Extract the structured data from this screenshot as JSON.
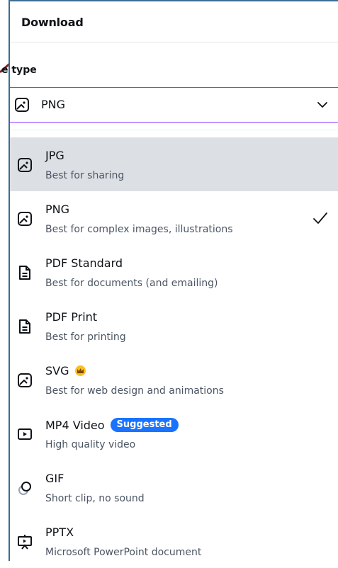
{
  "header": {
    "title": "Download"
  },
  "file_type": {
    "label": "e type",
    "selected": "PNG"
  },
  "options": [
    {
      "title": "JPG",
      "desc": "Best for sharing",
      "icon": "image-icon"
    },
    {
      "title": "PNG",
      "desc": "Best for complex images, illustrations",
      "icon": "image-icon",
      "checked": true
    },
    {
      "title": "PDF Standard",
      "desc": "Best for documents (and emailing)",
      "icon": "document-icon"
    },
    {
      "title": "PDF Print",
      "desc": "Best for printing",
      "icon": "document-icon"
    },
    {
      "title": "SVG",
      "desc": "Best for web design and animations",
      "icon": "image-icon",
      "premium": true
    },
    {
      "title": "MP4 Video",
      "desc": "High quality video",
      "icon": "video-icon",
      "badge": "Suggested"
    },
    {
      "title": "GIF",
      "desc": "Short clip, no sound",
      "icon": "gif-icon"
    },
    {
      "title": "PPTX",
      "desc": "Microsoft PowerPoint document",
      "icon": "presentation-icon"
    }
  ],
  "colors": {
    "accent": "#8b3dff",
    "badge": "#1a73ff",
    "highlight": "#dcdfe4",
    "arrow": "#8b1a1a"
  }
}
